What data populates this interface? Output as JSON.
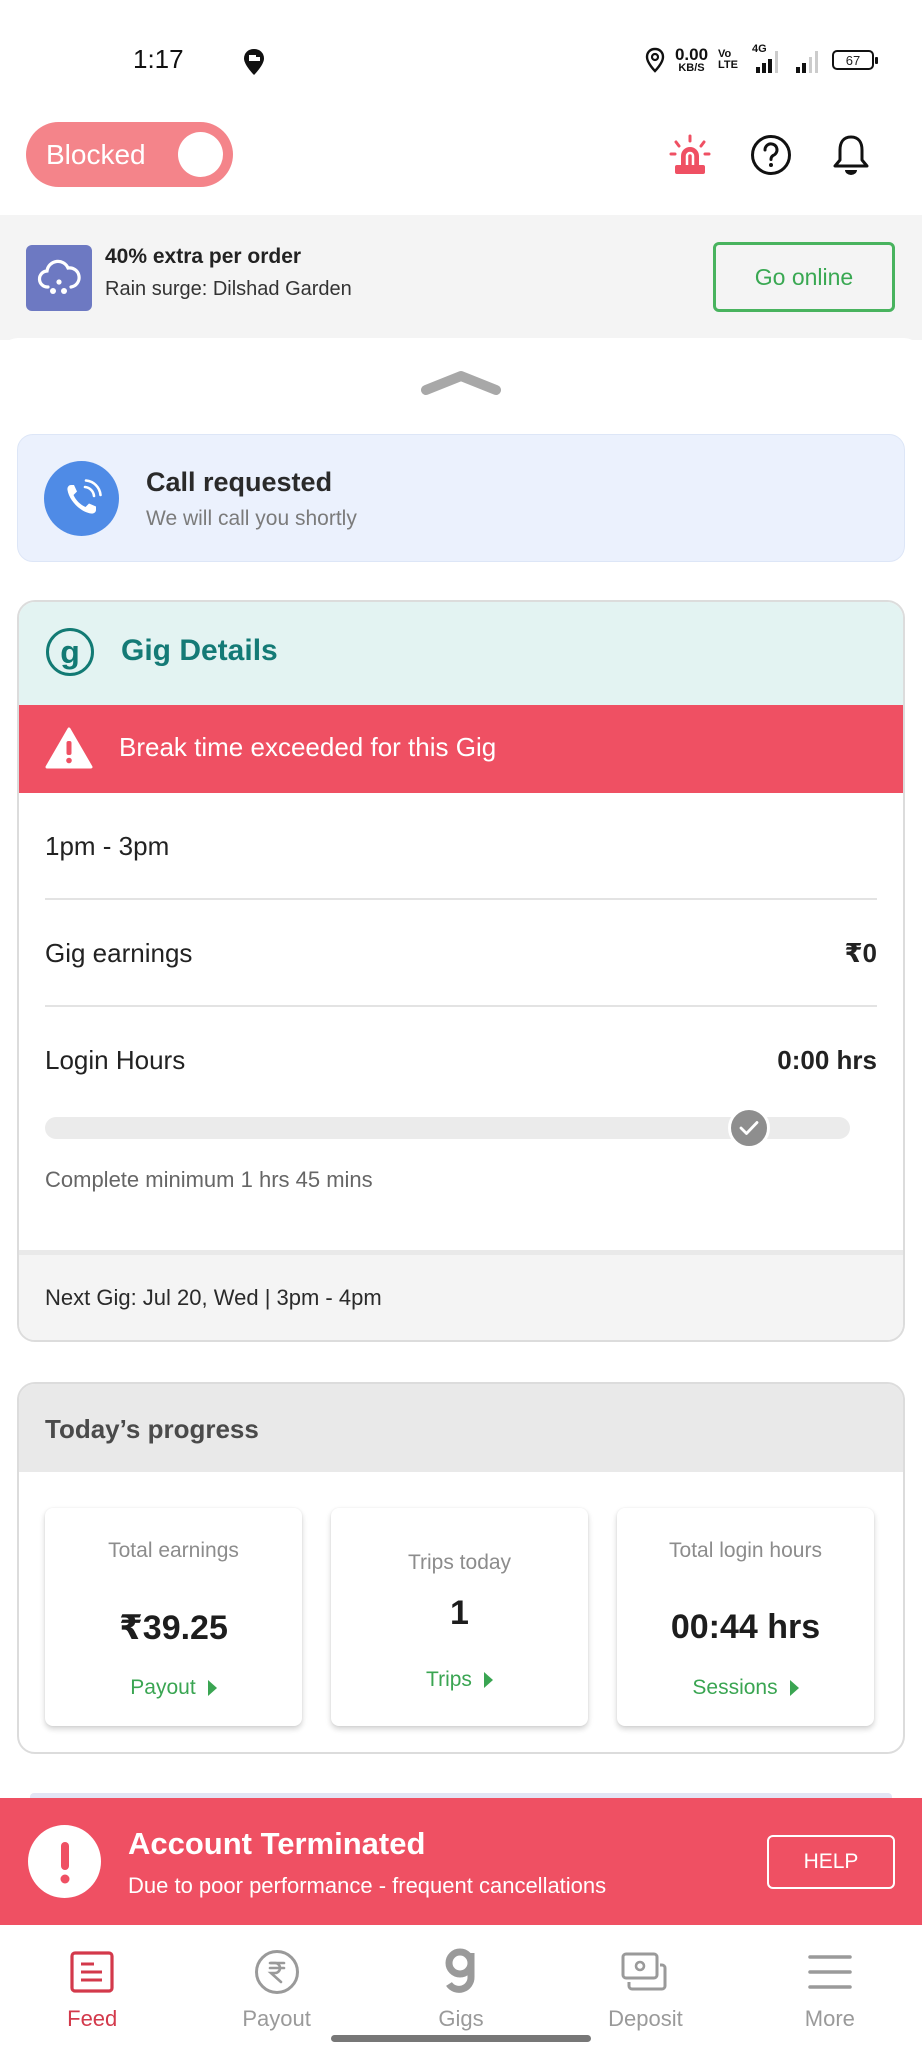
{
  "status_bar": {
    "time": "1:17",
    "net_speed_value": "0.00",
    "net_speed_unit": "KB/S",
    "volte_top": "Vo",
    "volte_bottom": "LTE",
    "network_type": "4G",
    "battery_percent": "67"
  },
  "header": {
    "duty_toggle_label": "Blocked",
    "duty_toggle_on": false,
    "icons": [
      "sos-alarm-icon",
      "help-icon",
      "notification-bell-icon"
    ]
  },
  "surge_banner": {
    "icon": "rain-cloud-icon",
    "title": "40% extra per order",
    "subtitle": "Rain surge: Dilshad Garden",
    "button_label": "Go online"
  },
  "call_card": {
    "icon": "phone-ringing-icon",
    "title": "Call requested",
    "subtitle": "We will call you shortly"
  },
  "gig_details": {
    "title": "Gig Details",
    "logo_letter": "g",
    "alert": "Break time exceeded for this Gig",
    "time_slot": "1pm - 3pm",
    "earnings_label": "Gig earnings",
    "earnings_value": "₹0",
    "login_label": "Login Hours",
    "login_value": "0:00 hrs",
    "login_progress_fraction": 0,
    "milestone_fraction": 0.875,
    "progress_hint": "Complete minimum 1 hrs 45 mins",
    "next_gig": "Next Gig: Jul 20, Wed | 3pm - 4pm"
  },
  "todays_progress": {
    "title": "Today’s progress",
    "tiles": [
      {
        "label": "Total earnings",
        "value": "₹39.25",
        "link": "Payout"
      },
      {
        "label": "Trips today",
        "value": "1",
        "link": "Trips"
      },
      {
        "label": "Total login hours",
        "value": "00:44 hrs",
        "link": "Sessions"
      }
    ]
  },
  "termination_banner": {
    "title": "Account Terminated",
    "subtitle": "Due to poor performance - frequent cancellations",
    "button_label": "HELP"
  },
  "bottom_nav": {
    "active": "Feed",
    "items": [
      {
        "label": "Feed",
        "icon": "feed-icon"
      },
      {
        "label": "Payout",
        "icon": "rupee-icon"
      },
      {
        "label": "Gigs",
        "icon": "gigs-logo-icon"
      },
      {
        "label": "Deposit",
        "icon": "cash-deposit-icon"
      },
      {
        "label": "More",
        "icon": "menu-icon"
      }
    ]
  },
  "colors": {
    "brand_red": "#ef5063",
    "brand_teal": "#147a76",
    "success_green": "#3aa552",
    "blocked_pink": "#f4848a",
    "call_blue": "#4f8be6",
    "surge_purple": "#6d79c2"
  }
}
